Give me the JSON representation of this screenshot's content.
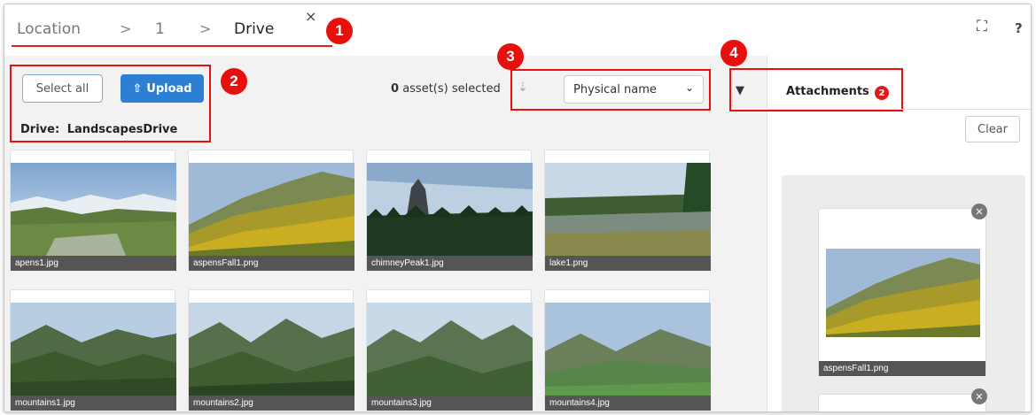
{
  "breadcrumb": {
    "items": [
      "Location",
      "1",
      "Drive"
    ],
    "separator": ">"
  },
  "header": {
    "close_glyph": "×",
    "fullscreen_glyph": "⛶",
    "help_glyph": "?"
  },
  "callouts": [
    "1",
    "2",
    "3",
    "4"
  ],
  "toolbar": {
    "select_all_label": "Select all",
    "upload_label": "Upload",
    "drive_label": "Drive:",
    "drive_value": "LandscapesDrive",
    "selected_count": "0",
    "selected_suffix": "asset(s) selected",
    "sort_value": "Physical name"
  },
  "assets": [
    {
      "name": "apens1.jpg"
    },
    {
      "name": "aspensFall1.png"
    },
    {
      "name": "chimneyPeak1.jpg"
    },
    {
      "name": "lake1.png"
    },
    {
      "name": "mountains1.jpg"
    },
    {
      "name": "mountains2.jpg"
    },
    {
      "name": "mountains3.jpg"
    },
    {
      "name": "mountains4.jpg"
    }
  ],
  "panel": {
    "tab_label": "Attachments",
    "badge_count": "2",
    "clear_label": "Clear",
    "attachments": [
      {
        "name": "aspensFall1.png"
      },
      {
        "name": ""
      }
    ]
  },
  "colors": {
    "accent": "#2d7fd3",
    "callout_red": "#e8100c",
    "caption_bg": "#555555"
  }
}
